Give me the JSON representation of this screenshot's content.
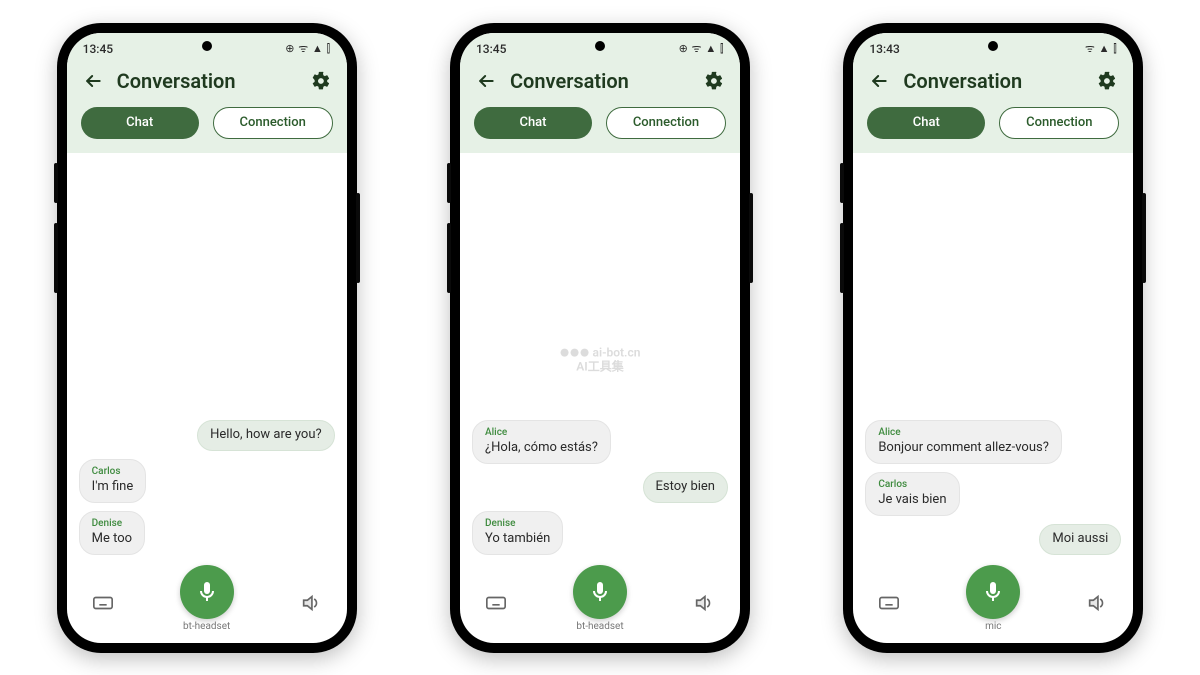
{
  "watermark": {
    "line1": "ai-bot.cn",
    "line2": "AI工具集"
  },
  "phones": [
    {
      "statusTime": "13:45",
      "statusIcons": "⊕ ᯤ ▲ ⫿",
      "title": "Conversation",
      "tabs": {
        "chat": "Chat",
        "connection": "Connection"
      },
      "messages": [
        {
          "side": "right",
          "sender": "",
          "text": "Hello, how are you?"
        },
        {
          "side": "left",
          "sender": "Carlos",
          "text": "I'm fine"
        },
        {
          "side": "left",
          "sender": "Denise",
          "text": "Me too"
        }
      ],
      "micLabel": "bt-headset"
    },
    {
      "statusTime": "13:45",
      "statusIcons": "⊕ ᯤ ▲ ⫿",
      "title": "Conversation",
      "tabs": {
        "chat": "Chat",
        "connection": "Connection"
      },
      "messages": [
        {
          "side": "left",
          "sender": "Alice",
          "text": "¿Hola, cómo estás?"
        },
        {
          "side": "right",
          "sender": "",
          "text": "Estoy bien"
        },
        {
          "side": "left",
          "sender": "Denise",
          "text": "Yo también"
        }
      ],
      "micLabel": "bt-headset"
    },
    {
      "statusTime": "13:43",
      "statusIcons": "ᯤ ▲ ⫿",
      "title": "Conversation",
      "tabs": {
        "chat": "Chat",
        "connection": "Connection"
      },
      "messages": [
        {
          "side": "left",
          "sender": "Alice",
          "text": "Bonjour comment allez-vous?"
        },
        {
          "side": "left",
          "sender": "Carlos",
          "text": "Je vais bien"
        },
        {
          "side": "right",
          "sender": "",
          "text": "Moi aussi"
        }
      ],
      "micLabel": "mic"
    }
  ]
}
